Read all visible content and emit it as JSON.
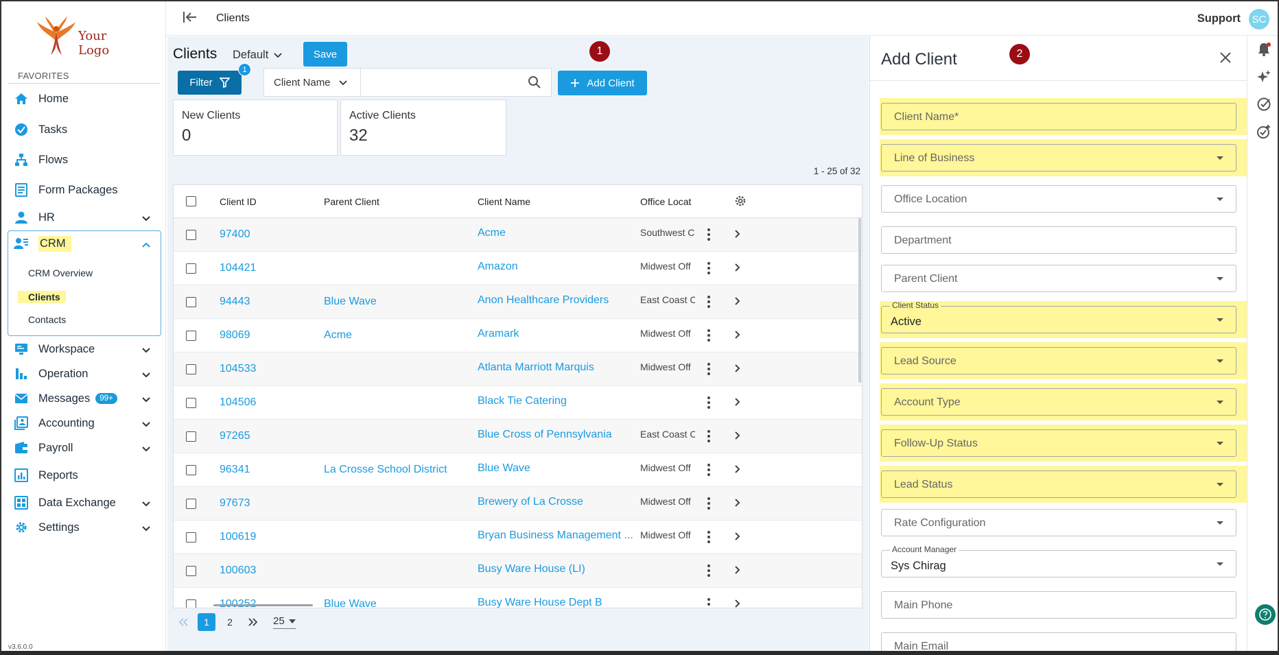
{
  "app": {
    "logo_text": "Your Logo",
    "version": "v3.6.0.0",
    "brand_color": "#1a9be0"
  },
  "topbar": {
    "title": "Clients",
    "support_label": "Support",
    "avatar_initials": "SC"
  },
  "sidebar": {
    "favorites_label": "FAVORITES",
    "items": [
      {
        "label": "Home",
        "icon": "home-icon"
      },
      {
        "label": "Tasks",
        "icon": "check-circle-icon"
      },
      {
        "label": "Flows",
        "icon": "flow-icon"
      },
      {
        "label": "Form Packages",
        "icon": "form-icon"
      },
      {
        "label": "HR",
        "icon": "person-icon"
      },
      {
        "label": "CRM",
        "icon": "crm-icon"
      },
      {
        "label": "Workspace",
        "icon": "monitor-icon"
      },
      {
        "label": "Operation",
        "icon": "bar-chart-icon"
      },
      {
        "label": "Messages",
        "icon": "mail-icon",
        "badge": "99+"
      },
      {
        "label": "Accounting",
        "icon": "accounting-icon"
      },
      {
        "label": "Payroll",
        "icon": "wallet-icon"
      },
      {
        "label": "Reports",
        "icon": "report-icon"
      },
      {
        "label": "Data Exchange",
        "icon": "grid-icon"
      },
      {
        "label": "Settings",
        "icon": "gear-icon"
      }
    ],
    "crm_sub": [
      "CRM Overview",
      "Clients",
      "Contacts"
    ]
  },
  "main": {
    "heading": "Clients",
    "view_name": "Default",
    "save_label": "Save",
    "filter_label": "Filter",
    "filter_count": "1",
    "search_field": "Client Name",
    "search_value": "",
    "add_label": "Add Client",
    "marker_1": "1",
    "stats": [
      {
        "label": "New Clients",
        "value": "0"
      },
      {
        "label": "Active Clients",
        "value": "32"
      }
    ],
    "range": "1 - 25 of 32",
    "columns": [
      "Client ID",
      "Parent Client",
      "Client Name",
      "Office Locat"
    ],
    "rows": [
      {
        "id": "97400",
        "parent": "",
        "name": "Acme",
        "office": "Southwest C"
      },
      {
        "id": "104421",
        "parent": "",
        "name": "Amazon",
        "office": "Midwest Off"
      },
      {
        "id": "94443",
        "parent": "Blue Wave",
        "name": "Anon Healthcare Providers",
        "office": "East Coast C"
      },
      {
        "id": "98069",
        "parent": "Acme",
        "name": "Aramark",
        "office": "Midwest Off"
      },
      {
        "id": "104533",
        "parent": "",
        "name": "Atlanta Marriott Marquis",
        "office": "Midwest Off"
      },
      {
        "id": "104506",
        "parent": "",
        "name": "Black Tie Catering",
        "office": ""
      },
      {
        "id": "97265",
        "parent": "",
        "name": "Blue Cross of Pennsylvania",
        "office": "East Coast C"
      },
      {
        "id": "96341",
        "parent": "La Crosse School District",
        "name": "Blue Wave",
        "office": "Midwest Off"
      },
      {
        "id": "97673",
        "parent": "",
        "name": "Brewery of La Crosse",
        "office": "Midwest Off"
      },
      {
        "id": "100619",
        "parent": "",
        "name": "Bryan Business Management ...",
        "office": "Midwest Off"
      },
      {
        "id": "100603",
        "parent": "",
        "name": "Busy Ware House (LI)",
        "office": ""
      },
      {
        "id": "100252",
        "parent": "Blue Wave",
        "name": "Busy Ware House Dept B",
        "office": ""
      }
    ],
    "pager": {
      "pages": [
        "1",
        "2"
      ],
      "current": "1",
      "page_size": "25"
    }
  },
  "drawer": {
    "title": "Add Client",
    "marker_2": "2",
    "highlight_color": "#fff799",
    "fields": [
      {
        "placeholder": "Client Name*",
        "type": "text",
        "highlighted": true
      },
      {
        "placeholder": "Line of Business",
        "type": "select",
        "highlighted": true
      },
      {
        "placeholder": "Office Location",
        "type": "select",
        "highlighted": false
      },
      {
        "placeholder": "Department",
        "type": "text",
        "highlighted": false
      },
      {
        "placeholder": "Parent Client",
        "type": "select",
        "highlighted": false
      },
      {
        "label": "Client Status",
        "value": "Active",
        "type": "select",
        "highlighted": true
      },
      {
        "placeholder": "Lead Source",
        "type": "select",
        "highlighted": true
      },
      {
        "placeholder": "Account Type",
        "type": "select",
        "highlighted": true
      },
      {
        "placeholder": "Follow-Up Status",
        "type": "select",
        "highlighted": true
      },
      {
        "placeholder": "Lead Status",
        "type": "select",
        "highlighted": true
      },
      {
        "placeholder": "Rate Configuration",
        "type": "select",
        "highlighted": false
      },
      {
        "label": "Account Manager",
        "value": "Sys Chirag",
        "type": "select",
        "highlighted": false
      },
      {
        "placeholder": "Main Phone",
        "type": "text",
        "highlighted": false
      },
      {
        "placeholder": "Main Email",
        "type": "text",
        "highlighted": false
      }
    ]
  },
  "rail": {
    "icons": [
      "bell-icon",
      "sparkle-icon",
      "check-circle-icon",
      "check-plus-icon",
      "help-icon"
    ]
  }
}
